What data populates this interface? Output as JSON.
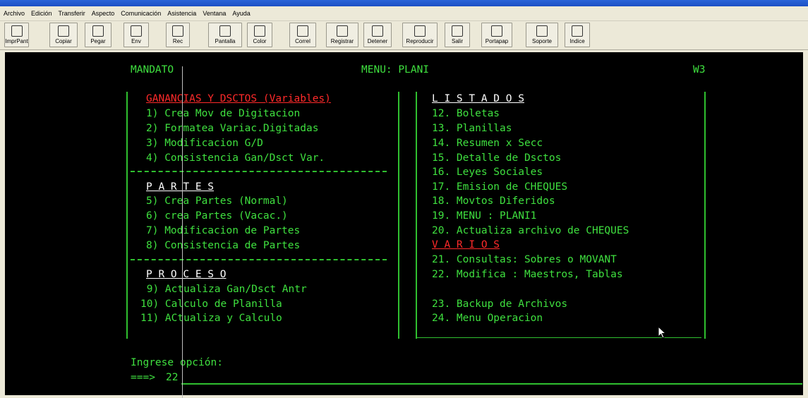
{
  "menubar": [
    "Archivo",
    "Edición",
    "Transferir",
    "Aspecto",
    "Comunicación",
    "Asistencia",
    "Ventana",
    "Ayuda"
  ],
  "toolbar": [
    {
      "label": "ImprPant",
      "icon": "print-icon"
    },
    {
      "label": "Copiar",
      "icon": "copy-icon"
    },
    {
      "label": "Pegar",
      "icon": "paste-icon"
    },
    {
      "label": "Env",
      "icon": "send-icon"
    },
    {
      "label": "Rec",
      "icon": "receive-icon"
    },
    {
      "label": "Pantalla",
      "icon": "screen-icon"
    },
    {
      "label": "Color",
      "icon": "color-icon"
    },
    {
      "label": "Correl",
      "icon": "correl-icon"
    },
    {
      "label": "Registrar",
      "icon": "record-icon"
    },
    {
      "label": "Detener",
      "icon": "stop-icon"
    },
    {
      "label": "Reproducir",
      "icon": "play-icon"
    },
    {
      "label": "Salir",
      "icon": "exit-icon"
    },
    {
      "label": "Portapap",
      "icon": "clipboard-icon"
    },
    {
      "label": "Soporte",
      "icon": "globe-icon"
    },
    {
      "label": "Indice",
      "icon": "book-icon"
    }
  ],
  "terminal": {
    "header_left": "MANDATO",
    "header_center": "MENU: PLANI",
    "header_right": "W3",
    "left": {
      "section1_title": "GANANCIAS Y DSCTOS (Variables)",
      "section1_items": [
        "1) Crea Mov de Digitacion",
        "2) Formatea Variac.Digitadas",
        "3) Modificacion G/D",
        "4) Consistencia Gan/Dsct Var."
      ],
      "section2_title": "P A R T E S",
      "section2_items": [
        "5) Crea Partes (Normal)",
        "6) crea Partes (Vacac.)",
        "7) Modificacion de Partes",
        "8) Consistencia de Partes"
      ],
      "section3_title": "P R O C E S O",
      "section3_items": [
        " 9) Actualiza Gan/Dsct Antr",
        "10) Calculo de Planilla",
        "11) ACtualiza y Calculo"
      ]
    },
    "right": {
      "listados_title": "L I S T A D O S",
      "listados_items": [
        "12. Boletas",
        "13. Planillas",
        "14. Resumen x Secc",
        "15. Detalle de Dsctos",
        "16. Leyes Sociales",
        "17. Emision de CHEQUES",
        "18. Movtos Diferidos",
        "19. MENU : PLANI1",
        "20. Actualiza archivo de CHEQUES"
      ],
      "varios_title": "V A R I O S",
      "varios_items": [
        "21. Consultas: Sobres o MOVANT",
        "22. Modifica : Maestros, Tablas"
      ],
      "other_items": [
        "23. Backup de Archivos",
        "24. Menu Operacion"
      ]
    },
    "prompt_label": "Ingrese opción:",
    "prompt_arrow": "===>",
    "prompt_value": "22"
  },
  "colors": {
    "terminal_bg": "#000000",
    "terminal_text": "#3fe03f",
    "highlight_red": "#ff2a2a",
    "header_white": "#ffffff"
  }
}
